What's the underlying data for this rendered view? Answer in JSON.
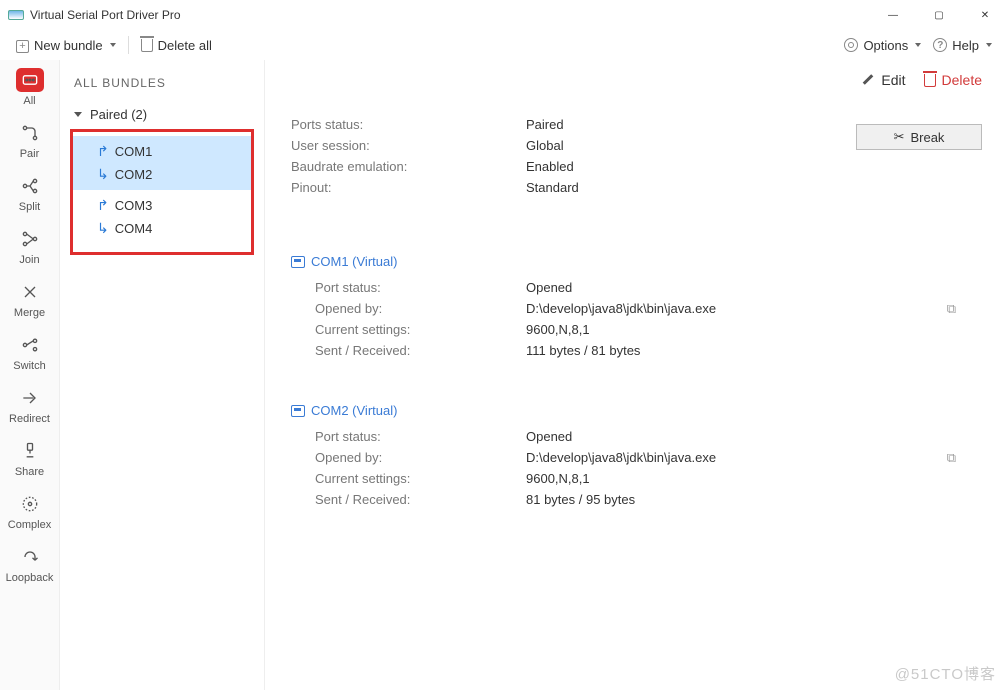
{
  "title": "Virtual Serial Port Driver Pro",
  "toolbar": {
    "new_bundle": "New bundle",
    "delete_all": "Delete all",
    "options": "Options",
    "help": "Help"
  },
  "sidebar": {
    "items": [
      {
        "label": "All"
      },
      {
        "label": "Pair"
      },
      {
        "label": "Split"
      },
      {
        "label": "Join"
      },
      {
        "label": "Merge"
      },
      {
        "label": "Switch"
      },
      {
        "label": "Redirect"
      },
      {
        "label": "Share"
      },
      {
        "label": "Complex"
      },
      {
        "label": "Loopback"
      }
    ]
  },
  "tree": {
    "heading": "ALL BUNDLES",
    "group_label": "Paired (2)",
    "pairs": [
      {
        "a": "COM1",
        "b": "COM2"
      },
      {
        "a": "COM3",
        "b": "COM4"
      }
    ]
  },
  "actions": {
    "edit": "Edit",
    "delete": "Delete",
    "break": "Break"
  },
  "summary": {
    "ports_status_label": "Ports status:",
    "ports_status_value": "Paired",
    "user_session_label": "User session:",
    "user_session_value": "Global",
    "baudrate_label": "Baudrate emulation:",
    "baudrate_value": "Enabled",
    "pinout_label": "Pinout:",
    "pinout_value": "Standard"
  },
  "ports": [
    {
      "name": "COM1 (Virtual)",
      "status_label": "Port status:",
      "status_value": "Opened",
      "opened_by_label": "Opened by:",
      "opened_by_value": "D:\\develop\\java8\\jdk\\bin\\java.exe",
      "settings_label": "Current settings:",
      "settings_value": "9600,N,8,1",
      "sent_label": "Sent / Received:",
      "sent_value": "111 bytes / 81 bytes"
    },
    {
      "name": "COM2 (Virtual)",
      "status_label": "Port status:",
      "status_value": "Opened",
      "opened_by_label": "Opened by:",
      "opened_by_value": "D:\\develop\\java8\\jdk\\bin\\java.exe",
      "settings_label": "Current settings:",
      "settings_value": "9600,N,8,1",
      "sent_label": "Sent / Received:",
      "sent_value": "81 bytes / 95 bytes"
    }
  ],
  "watermark": "@51CTO博客"
}
